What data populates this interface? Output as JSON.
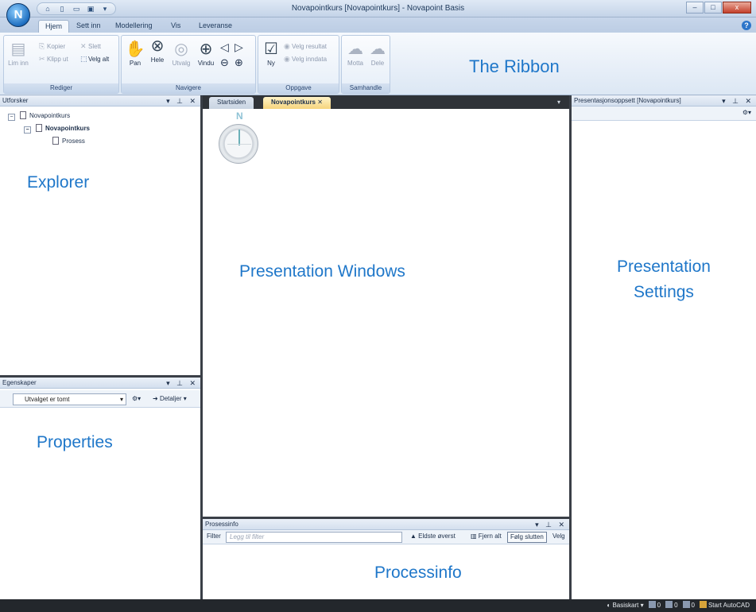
{
  "window": {
    "title": "Novapointkurs [Novapointkurs] - Novapoint Basis",
    "app_logo": "N",
    "controls": [
      "–",
      "□",
      "x"
    ]
  },
  "ribbon": {
    "tabs": [
      {
        "label": "Hjem",
        "active": true
      },
      {
        "label": "Sett inn",
        "active": false
      },
      {
        "label": "Modellering",
        "active": false
      },
      {
        "label": "Vis",
        "active": false
      },
      {
        "label": "Leveranse",
        "active": false
      }
    ],
    "help": "?",
    "groups": {
      "rediger": {
        "label": "Rediger",
        "lim_inn": "Lim inn",
        "kopier": "Kopier",
        "slett": "Slett",
        "klipp_ut": "Klipp ut",
        "velg_alt": "Velg alt"
      },
      "navigere": {
        "label": "Navigere",
        "pan": "Pan",
        "hele": "Hele",
        "utvalg": "Utvalg",
        "vindu": "Vindu"
      },
      "oppgave": {
        "label": "Oppgave",
        "ny": "Ny",
        "velg_resultat": "Velg resultat",
        "velg_inndata": "Velg inndata"
      },
      "samhandle": {
        "label": "Samhandle",
        "motta": "Motta",
        "dele": "Dele"
      }
    },
    "annotation": "The Ribbon"
  },
  "explorer": {
    "title": "Utforsker",
    "tree": {
      "root": "Novapointkurs",
      "child": "Novapointkurs",
      "leaf": "Prosess"
    },
    "annotation": "Explorer"
  },
  "properties": {
    "title": "Egenskaper",
    "select_value": "Utvalget er tomt",
    "details_button": "Detaljer",
    "annotation": "Properties"
  },
  "center": {
    "tabs": [
      {
        "label": "Startsiden",
        "active": false
      },
      {
        "label": "Novapointkurs",
        "active": true
      }
    ],
    "compass_label": "N",
    "annotation": "Presentation Windows"
  },
  "processinfo": {
    "title": "Prosessinfo",
    "filter_label": "Filter",
    "filter_placeholder": "Legg til filter",
    "oldest_first": "Eldste øverst",
    "clear_all": "Fjern alt",
    "follow_end": "Følg slutten",
    "select": "Velg",
    "annotation": "Processinfo"
  },
  "presentation_settings": {
    "title": "Presentasjonsoppsett [Novapointkurs]",
    "annotation_line1": "Presentation",
    "annotation_line2": "Settings"
  },
  "statusbar": {
    "basemap": "Basiskart",
    "count_a": "0",
    "count_b": "0",
    "count_c": "0",
    "start_autocad": "Start AutoCAD"
  },
  "colors": {
    "annotation": "#1f77c9",
    "panel_border": "#3a3f47",
    "active_tab": "#f6d47c"
  }
}
